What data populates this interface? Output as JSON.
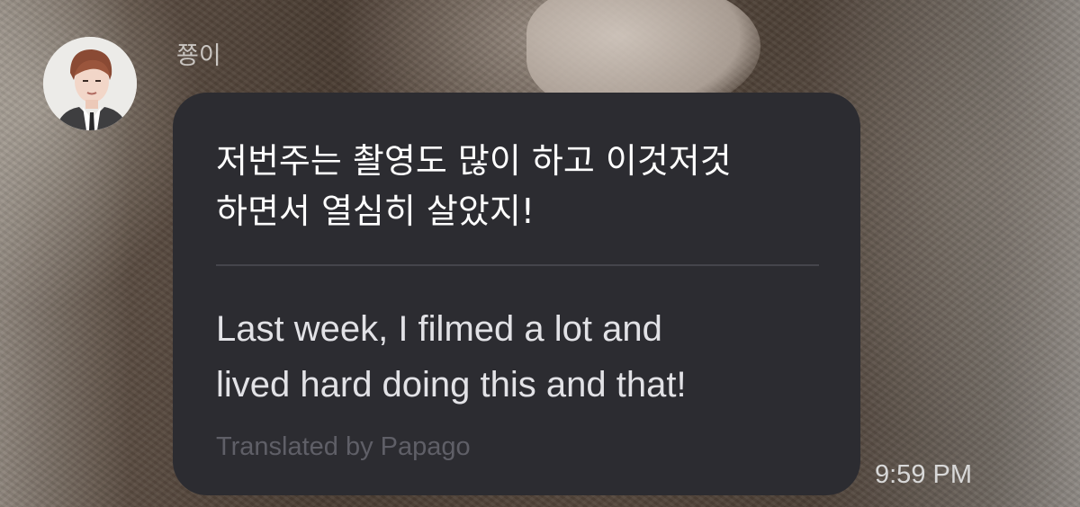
{
  "sender": {
    "name": "쭁이",
    "avatar_icon": "profile-photo"
  },
  "message": {
    "original_text": "저번주는 촬영도 많이 하고 이것저것\n하면서 열심히 살았지!",
    "translated_text": "Last week, I filmed a lot and\nlived hard doing this and that!",
    "translated_by": "Translated by Papago",
    "timestamp": "9:59 PM"
  },
  "colors": {
    "bubble": "#2c2c31",
    "original_text": "#ffffff",
    "translated_text": "#e2e2e6",
    "translated_by": "#5f5f67",
    "divider": "#45454c"
  }
}
